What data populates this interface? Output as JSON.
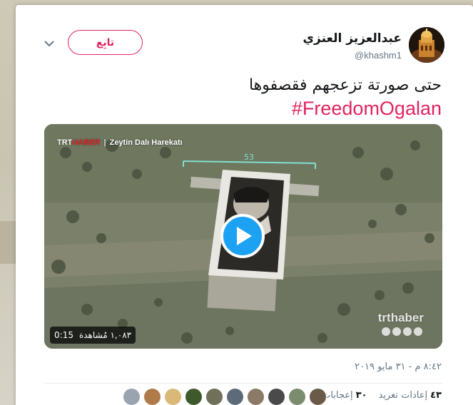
{
  "tweet": {
    "author_name": "عبدالعزيز العنزي",
    "author_handle": "@khashm1",
    "follow_label": "تابِع",
    "text": "حتى صورتة تزعجهم فقصفوها",
    "hashtag": "#FreedomOgalan",
    "timestamp": "٨:٤٢ م - ٣١ مايو ٢٠١٩"
  },
  "video": {
    "channel_trt": "TRT",
    "channel_haber": "HABER",
    "channel_program": "Zeytin Dalı Harekatı",
    "watermark": "trthaber",
    "overlay_number": "53",
    "duration": "0:15",
    "views": "١,٠٨٣ مُشاهدة"
  },
  "stats": {
    "retweets_count": "٤٣",
    "retweets_label": "إعادات تغريد",
    "likes_count": "٣٠",
    "likes_label": "إعجابات"
  },
  "likers": [
    {
      "icon": "avatar-1",
      "color": "#6b5a48"
    },
    {
      "icon": "avatar-2",
      "color": "#7c8c6e"
    },
    {
      "icon": "avatar-3",
      "color": "#4a4a4a"
    },
    {
      "icon": "avatar-4",
      "color": "#8a7a66"
    },
    {
      "icon": "avatar-5",
      "color": "#5c6a7a"
    },
    {
      "icon": "avatar-6",
      "color": "#6f6f5a"
    },
    {
      "icon": "avatar-7",
      "color": "#3e5a2c"
    },
    {
      "icon": "avatar-8",
      "color": "#d9b878"
    },
    {
      "icon": "avatar-9",
      "color": "#b07a4a"
    },
    {
      "icon": "avatar-10",
      "color": "#9aa4b0"
    }
  ],
  "colors": {
    "accent": "#e0245e",
    "play": "#1da1f2",
    "text": "#14171a",
    "muted": "#657786"
  }
}
